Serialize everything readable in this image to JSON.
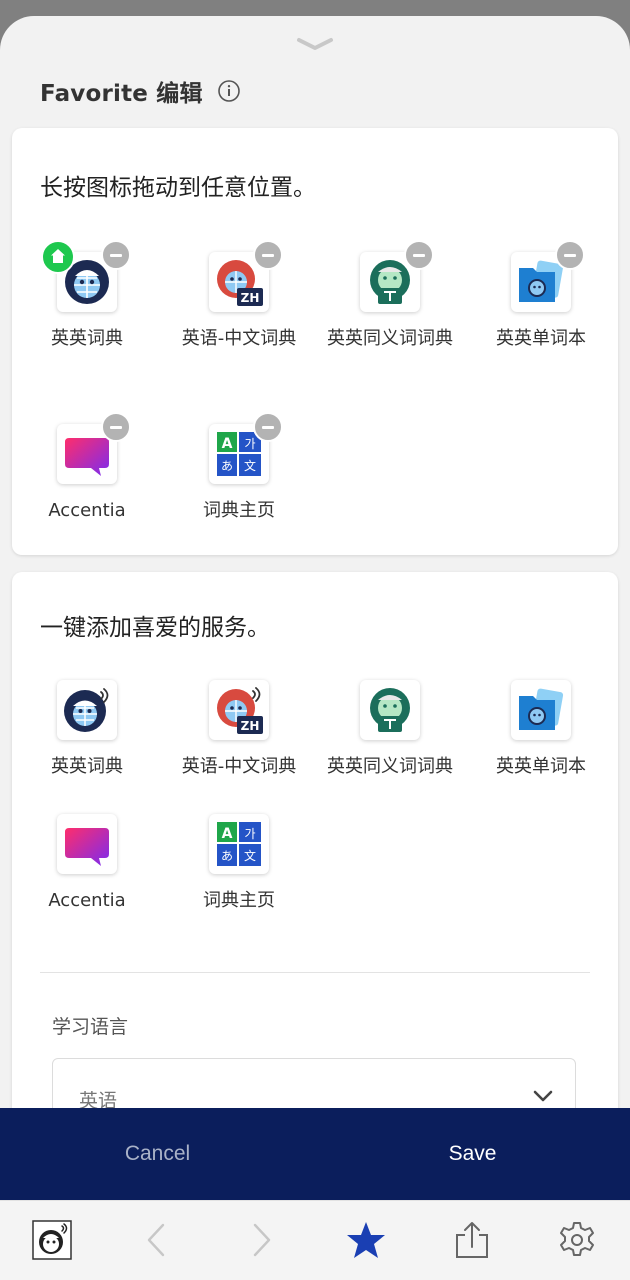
{
  "header": {
    "title": "Favorite 编辑",
    "info_icon": "info-icon"
  },
  "favorites": {
    "heading": "长按图标拖动到任意位置。",
    "items": [
      {
        "label": "英英词典",
        "icon": "globe-dictionary-icon",
        "badge": "home"
      },
      {
        "label": "英语-中文词典",
        "icon": "en-zh-dictionary-icon",
        "badge": "remove"
      },
      {
        "label": "英英同义词词典",
        "icon": "thesaurus-icon",
        "badge": "remove"
      },
      {
        "label": "英英单词本",
        "icon": "wordbook-folder-icon",
        "badge": "remove"
      },
      {
        "label": "Accentia",
        "icon": "accentia-icon",
        "badge": "remove"
      },
      {
        "label": "词典主页",
        "icon": "dictionary-home-icon",
        "badge": "remove"
      }
    ]
  },
  "services": {
    "heading": "一键添加喜爱的服务。",
    "items": [
      {
        "label": "英英词典",
        "icon": "globe-dictionary-audio-icon"
      },
      {
        "label": "英语-中文词典",
        "icon": "en-zh-dictionary-audio-icon"
      },
      {
        "label": "英英同义词词典",
        "icon": "thesaurus-icon"
      },
      {
        "label": "英英单词本",
        "icon": "wordbook-folder-icon"
      },
      {
        "label": "Accentia",
        "icon": "accentia-icon"
      },
      {
        "label": "词典主页",
        "icon": "dictionary-home-icon"
      }
    ]
  },
  "language": {
    "label": "学习语言",
    "selected": "英语"
  },
  "actions": {
    "cancel": "Cancel",
    "save": "Save"
  },
  "colors": {
    "accent_navy": "#0b1e5c",
    "star_blue": "#1a3fb3",
    "home_green": "#1ec84e",
    "remove_gray": "#b3b3b3"
  },
  "nav": {
    "icons": [
      "app-avatar-icon",
      "back-chevron-icon",
      "forward-chevron-icon",
      "favorite-star-icon",
      "share-icon",
      "settings-gear-icon"
    ]
  }
}
